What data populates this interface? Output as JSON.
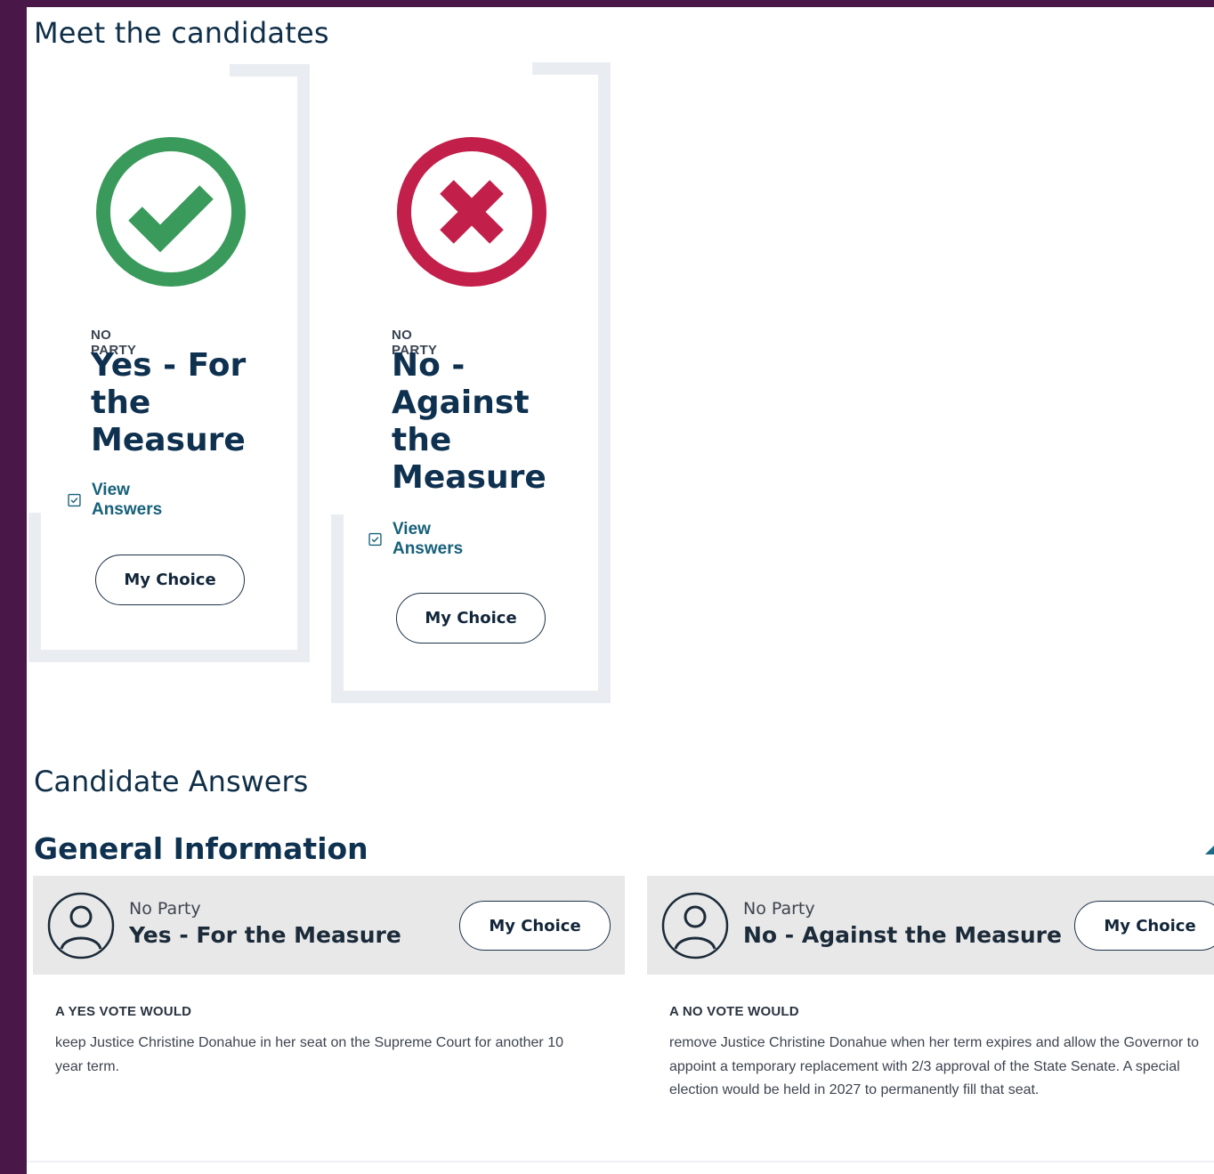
{
  "meet": {
    "title": "Meet the candidates"
  },
  "candidates": [
    {
      "party": "NO PARTY",
      "name": "Yes - For the Measure",
      "view_answers": "View Answers",
      "choice_label": "My Choice",
      "icon": "check-circle-icon",
      "color": "#3a9a5b"
    },
    {
      "party": "NO PARTY",
      "name": "No - Against the Measure",
      "view_answers": "View Answers",
      "choice_label": "My Choice",
      "icon": "x-circle-icon",
      "color": "#c2204a"
    }
  ],
  "answers": {
    "title": "Candidate Answers",
    "section_title": "General Information",
    "columns": [
      {
        "party": "No Party",
        "name": "Yes - For the Measure",
        "choice_label": "My Choice",
        "question_label": "A YES VOTE WOULD",
        "answer": "keep Justice Christine Donahue in her seat on the Supreme Court for another 10 year term."
      },
      {
        "party": "No Party",
        "name": "No - Against the Measure",
        "choice_label": "My Choice",
        "question_label": "A NO VOTE WOULD",
        "answer": "remove Justice Christine Donahue when her term expires and allow the Governor to appoint a temporary replacement with 2/3 approval of the State Senate. A special election would be held in 2027 to permanently fill that seat."
      }
    ]
  }
}
